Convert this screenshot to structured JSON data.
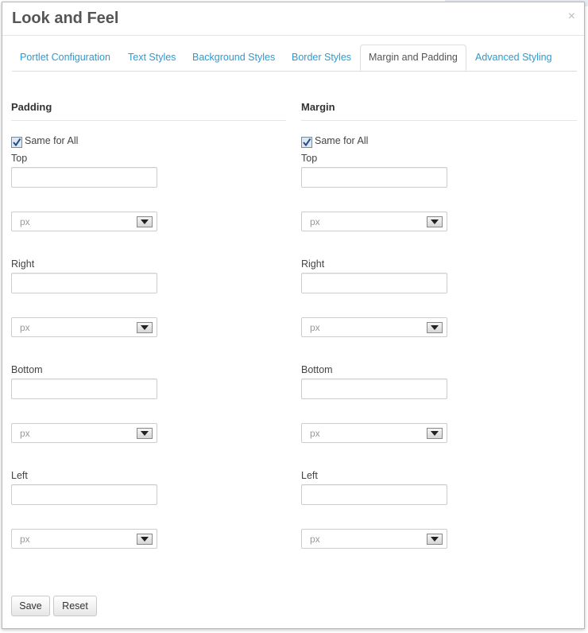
{
  "dialog": {
    "title": "Look and Feel",
    "close_glyph": "×"
  },
  "tabs": [
    {
      "label": "Portlet Configuration",
      "active": false
    },
    {
      "label": "Text Styles",
      "active": false
    },
    {
      "label": "Background Styles",
      "active": false
    },
    {
      "label": "Border Styles",
      "active": false
    },
    {
      "label": "Margin and Padding",
      "active": true
    },
    {
      "label": "Advanced Styling",
      "active": false
    }
  ],
  "padding": {
    "heading": "Padding",
    "same_for_all": {
      "label": "Same for All",
      "checked": true
    },
    "fields": [
      {
        "label": "Top",
        "value": "",
        "unit": "px"
      },
      {
        "label": "Right",
        "value": "",
        "unit": "px"
      },
      {
        "label": "Bottom",
        "value": "",
        "unit": "px"
      },
      {
        "label": "Left",
        "value": "",
        "unit": "px"
      }
    ]
  },
  "margin": {
    "heading": "Margin",
    "same_for_all": {
      "label": "Same for All",
      "checked": true
    },
    "fields": [
      {
        "label": "Top",
        "value": "",
        "unit": "px"
      },
      {
        "label": "Right",
        "value": "",
        "unit": "px"
      },
      {
        "label": "Bottom",
        "value": "",
        "unit": "px"
      },
      {
        "label": "Left",
        "value": "",
        "unit": "px"
      }
    ]
  },
  "buttons": {
    "save": "Save",
    "reset": "Reset"
  },
  "colors": {
    "tab_link": "#2b9bd3",
    "title": "#555555",
    "select_placeholder": "#999999"
  },
  "icons": {
    "close": "close-icon",
    "checkbox": "checkmark-icon",
    "select": "dropdown-arrow-icon"
  }
}
